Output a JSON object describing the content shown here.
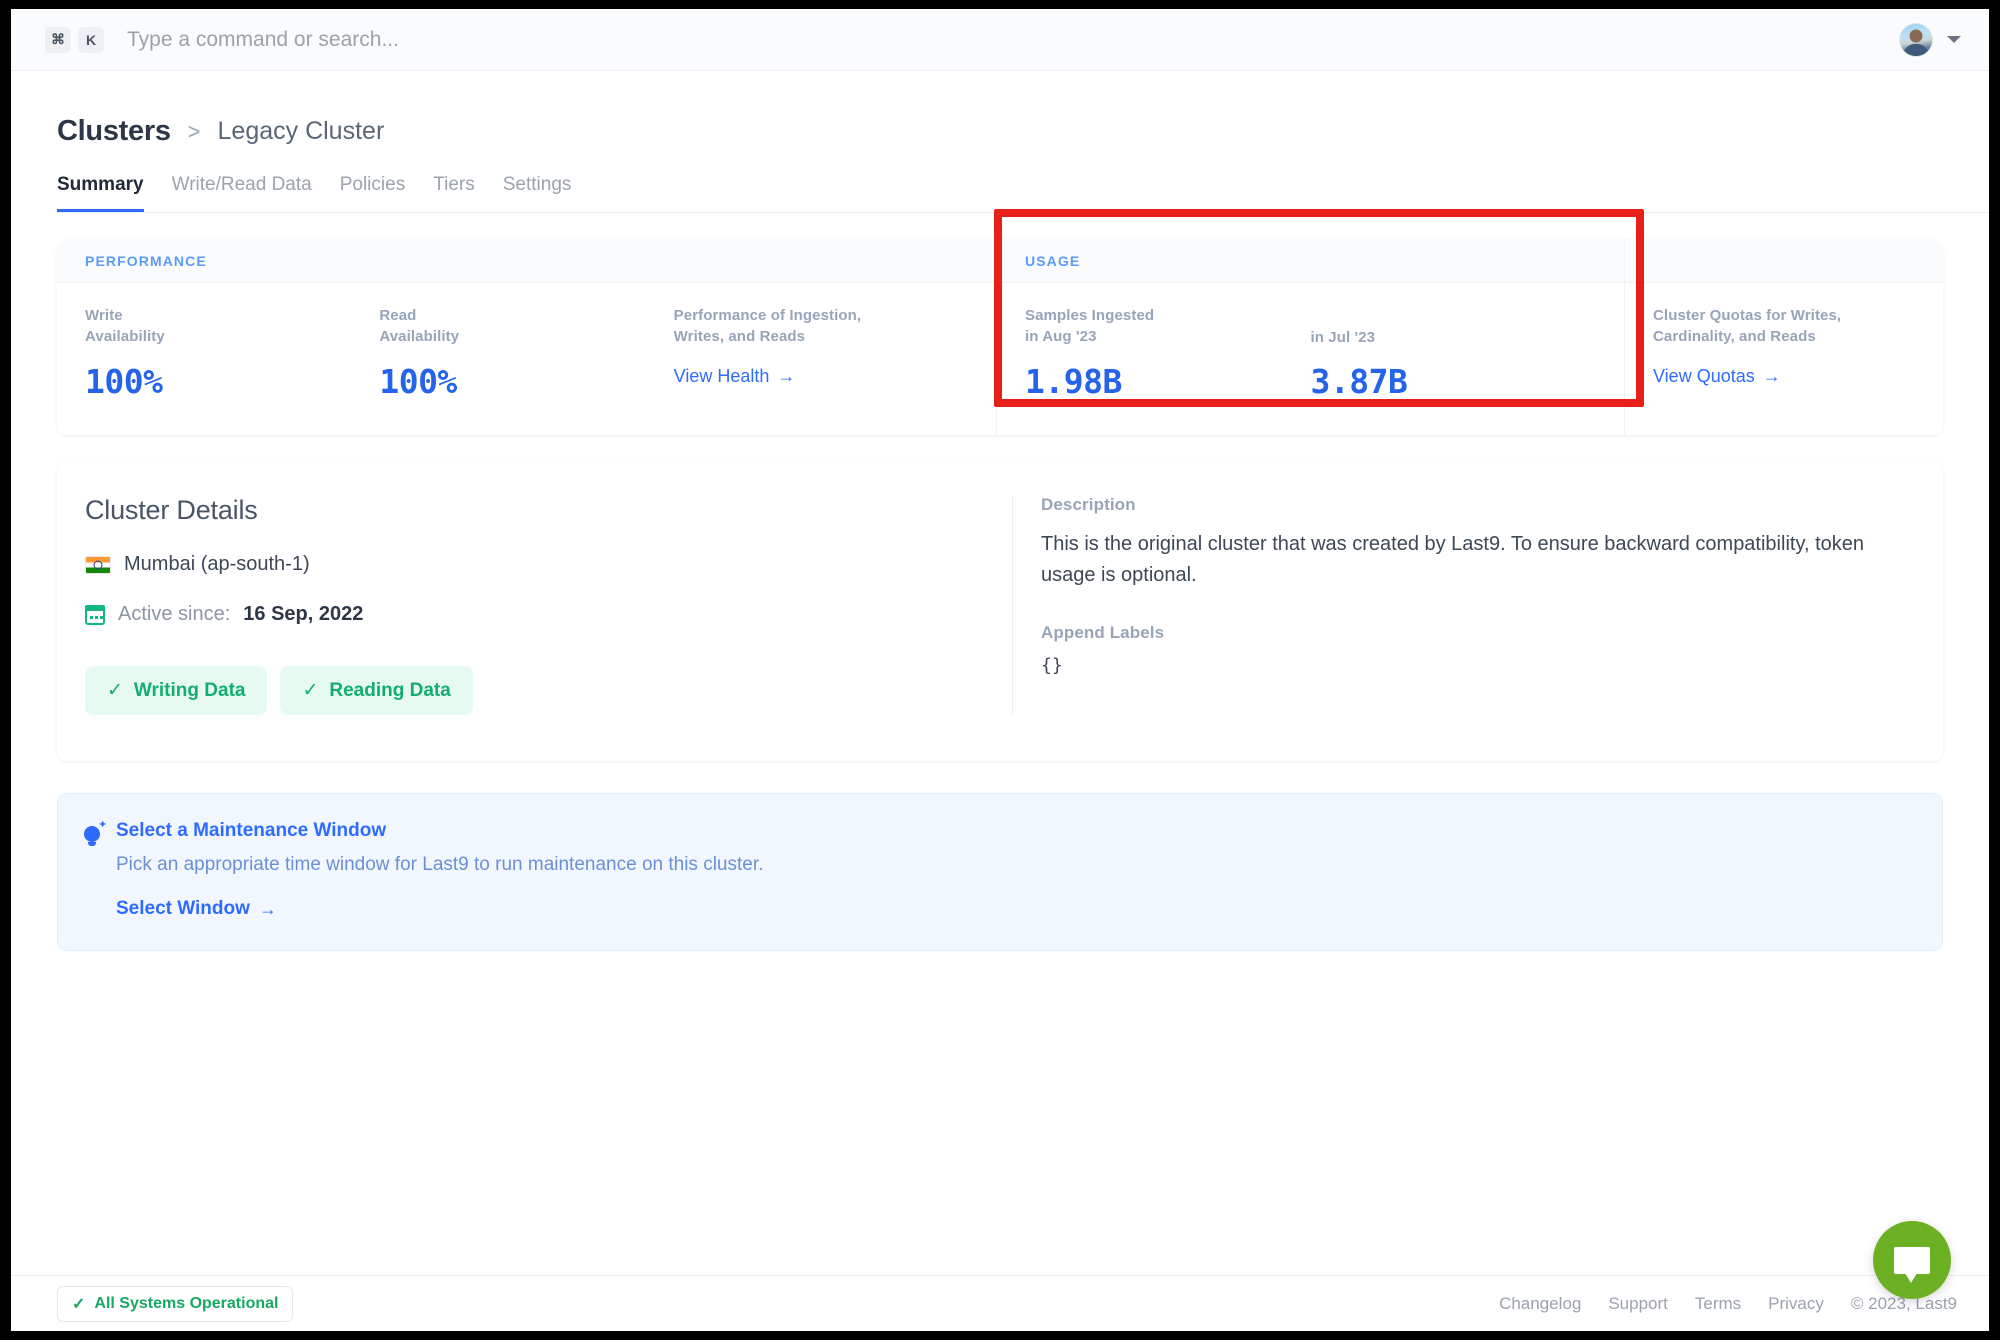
{
  "topbar": {
    "kbd_cmd": "⌘",
    "kbd_key": "K",
    "search_placeholder": "Type a command or search..."
  },
  "breadcrumb": {
    "root": "Clusters",
    "separator": ">",
    "leaf": "Legacy Cluster"
  },
  "tabs": [
    {
      "label": "Summary",
      "active": true
    },
    {
      "label": "Write/Read Data",
      "active": false
    },
    {
      "label": "Policies",
      "active": false
    },
    {
      "label": "Tiers",
      "active": false
    },
    {
      "label": "Settings",
      "active": false
    }
  ],
  "stats": {
    "performance": {
      "header": "PERFORMANCE",
      "write_label": "Write\nAvailability",
      "write_value": "100%",
      "read_label": "Read\nAvailability",
      "read_value": "100%"
    },
    "health": {
      "label": "Performance of Ingestion,\nWrites, and Reads",
      "link": "View Health",
      "arrow": "→"
    },
    "usage": {
      "header": "USAGE",
      "current_label": "Samples Ingested\nin Aug '23",
      "current_value": "1.98B",
      "previous_label": "in Jul '23",
      "previous_value": "3.87B"
    },
    "quotas": {
      "label": "Cluster Quotas for Writes,\nCardinality, and Reads",
      "link": "View Quotas",
      "arrow": "→"
    }
  },
  "details": {
    "title": "Cluster Details",
    "region": "Mumbai (ap-south-1)",
    "active_since_label": "Active since:",
    "active_since_value": "16 Sep, 2022",
    "badges": [
      {
        "check": "✓",
        "label": "Writing Data"
      },
      {
        "check": "✓",
        "label": "Reading Data"
      }
    ],
    "description_label": "Description",
    "description_text": "This is the original cluster that was created by Last9. To ensure backward compatibility, token usage is optional.",
    "append_labels_label": "Append Labels",
    "append_labels_value": "{}"
  },
  "banner": {
    "title": "Select a Maintenance Window",
    "description": "Pick an appropriate time window for Last9 to run maintenance on this cluster.",
    "link": "Select Window",
    "arrow": "→"
  },
  "footer": {
    "status_check": "✓",
    "status_label": "All Systems Operational",
    "links": [
      "Changelog",
      "Support",
      "Terms",
      "Privacy"
    ],
    "copyright": "© 2023, Last9"
  },
  "colors": {
    "accent_blue": "#2f6bff",
    "value_blue": "#2563eb",
    "success_green": "#13ad70",
    "annotation_red": "#e8201a",
    "chat_green": "#6cb024"
  }
}
